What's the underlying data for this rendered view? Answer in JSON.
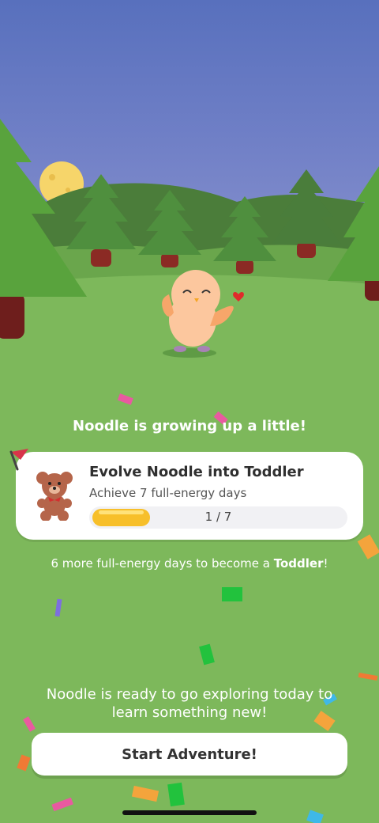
{
  "pet": {
    "name": "Noodle",
    "heart_icon": "heart-icon"
  },
  "headline": "Noodle is growing up a little!",
  "milestone": {
    "title": "Evolve Noodle into Toddler",
    "subtitle": "Achieve 7 full-energy days",
    "progress_text": "1 / 7",
    "progress_current": 1,
    "progress_total": 7,
    "icon": "teddy-bear-icon",
    "flag_icon": "flag-icon"
  },
  "goal": {
    "prefix": "6 more full-energy days to become a ",
    "stage": "Toddler",
    "suffix": "!"
  },
  "explore_text": "Noodle is ready to go exploring today to learn something new!",
  "start_button": "Start Adventure!",
  "colors": {
    "sky": "#5870bd",
    "grass": "#7db85b",
    "progress": "#f7bf2a",
    "bear": "#b5654a"
  }
}
